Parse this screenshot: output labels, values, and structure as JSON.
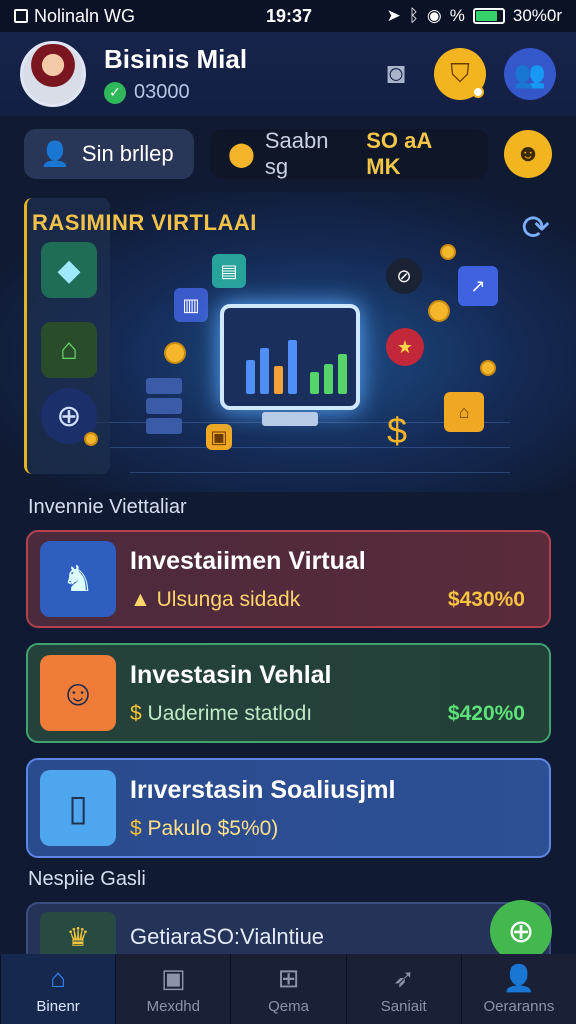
{
  "status_bar": {
    "carrier": "Nolinaln WG",
    "time": "19:37",
    "right_text": "% ",
    "battery_text": "30%0r"
  },
  "header": {
    "user_name": "Bisinis Mial",
    "user_sub": "03000",
    "icons": [
      "camera-icon",
      "shield-icon",
      "people-icon"
    ]
  },
  "toolbar": {
    "profile_label": "Sin brllep",
    "search_text": "Saabn sg",
    "search_highlight": "SO aA MK"
  },
  "hero": {
    "title": "RASIMINR VIRTLAAI"
  },
  "sections": {
    "investments_label": "Invennie Viettaliar",
    "more_label": "Nespiie Gasli"
  },
  "cards": [
    {
      "title": "Investaiimen Virtual",
      "sub": "Ulsunga sidadk",
      "amount": "$430%0",
      "accent": "#b3424e"
    },
    {
      "title": "Investasin Vehlal",
      "sub": "Uaderime statlodı",
      "amount": "$420%0",
      "accent": "#3fa36e"
    },
    {
      "title": "Irıverstasin Soaliusjml",
      "sub": "Pakulo",
      "amount": "$5%0)",
      "accent": "#5d86e6"
    }
  ],
  "partial_card": {
    "title": "GetiaraSO:Vialntiue"
  },
  "bottom_nav": [
    {
      "label": "Binenr",
      "icon": "home-icon",
      "active": true
    },
    {
      "label": "Mexdhd",
      "icon": "wallet-icon",
      "active": false
    },
    {
      "label": "Qema",
      "icon": "gamepad-icon",
      "active": false
    },
    {
      "label": "Saniait",
      "icon": "rocket-icon",
      "active": false
    },
    {
      "label": "Oeraranns",
      "icon": "profile-icon",
      "active": false
    }
  ]
}
